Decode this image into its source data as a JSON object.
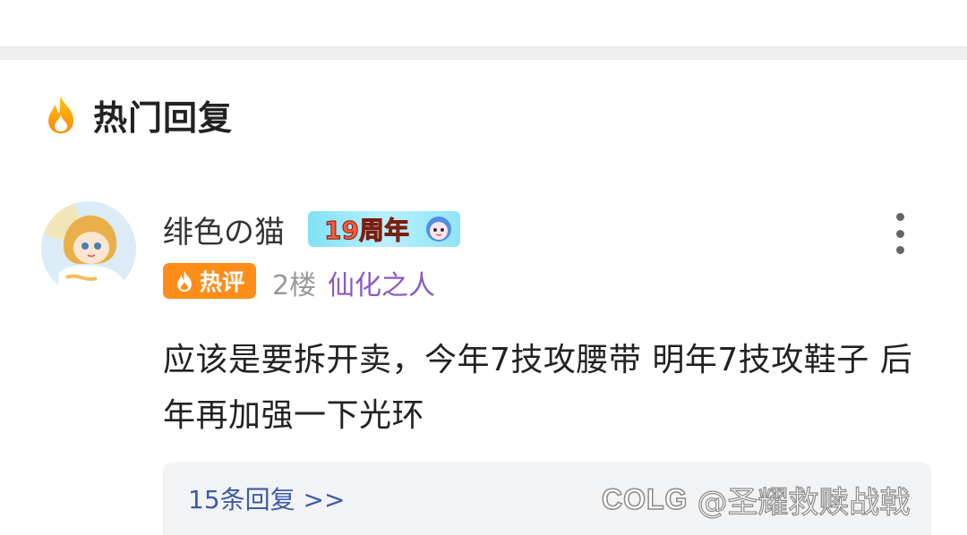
{
  "section": {
    "title": "热门回复",
    "icon": "fire-icon"
  },
  "comment": {
    "username": "绯色の猫",
    "anniversary_badge": "19周年",
    "hot_badge": "热评",
    "floor": "2楼",
    "user_title": "仙化之人",
    "content": "应该是要拆开卖，今年7技攻腰带 明年7技攻鞋子 后年再加强一下光环",
    "replies_link": "15条回复 >>",
    "colors": {
      "hot_badge": "#ff8d1a",
      "user_title": "#8a5ac6",
      "replies_link": "#3f5aa8"
    }
  },
  "watermark": {
    "logo": "COLG",
    "text": "@圣耀救赎战戟"
  }
}
